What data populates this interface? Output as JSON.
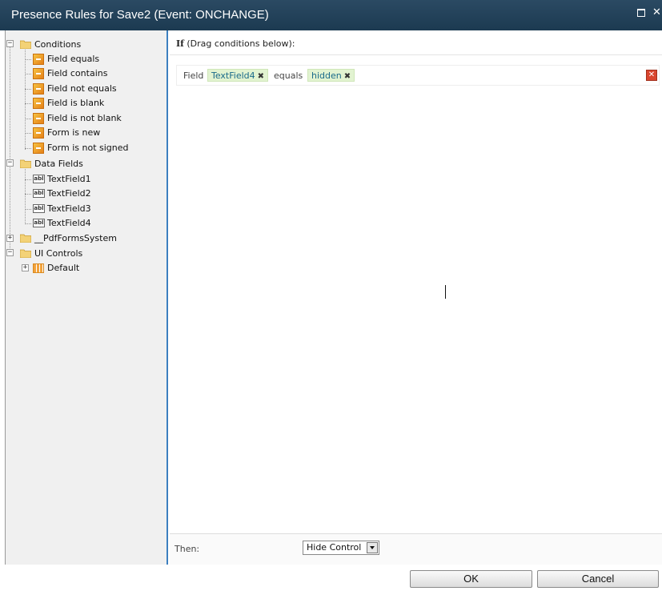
{
  "window": {
    "title": "Presence Rules for Save2 (Event: ONCHANGE)",
    "maximize_icon": "maximize-icon",
    "close_glyph": "✕"
  },
  "tree": {
    "conditions": {
      "label": "Conditions",
      "expander": "−",
      "items": [
        "Field equals",
        "Field contains",
        "Field not equals",
        "Field is blank",
        "Field is not blank",
        "Form is new",
        "Form is not signed"
      ]
    },
    "data_fields": {
      "label": "Data Fields",
      "expander": "−",
      "items": [
        "TextField1",
        "TextField2",
        "TextField3",
        "TextField4"
      ],
      "icon_text": "abl"
    },
    "pdf_forms_system": {
      "label": "__PdfFormsSystem",
      "expander": "+"
    },
    "ui_controls": {
      "label": "UI Controls",
      "expander": "−",
      "items": [
        {
          "label": "Default",
          "expander": "+"
        }
      ]
    }
  },
  "rule": {
    "if_label": "If",
    "if_hint": "(Drag conditions below):",
    "condition": {
      "field_label": "Field",
      "field_value": "TextField4",
      "operator": "equals",
      "value": "hidden",
      "remove_glyph": "✖",
      "delete_glyph": "✕"
    },
    "then_label": "Then:",
    "then_action": "Hide Control"
  },
  "footer": {
    "ok_label": "OK",
    "cancel_label": "Cancel"
  },
  "colors": {
    "titlebar": "#1f3e56",
    "pane_divider": "#3c7fc0",
    "chip_bg": "#e2f3d1",
    "delete_button": "#d9462f"
  }
}
